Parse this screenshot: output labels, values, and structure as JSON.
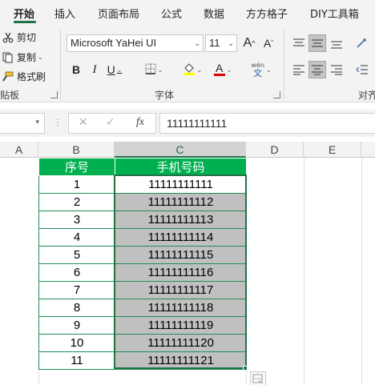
{
  "tabs": [
    "开始",
    "插入",
    "页面布局",
    "公式",
    "数据",
    "方方格子",
    "DIY工具箱"
  ],
  "clipboard": {
    "cut": "剪切",
    "copy": "复制",
    "format_painter": "格式刷",
    "group_label": "贴板"
  },
  "font": {
    "name": "Microsoft YaHei UI",
    "size": "11",
    "bold": "B",
    "italic": "I",
    "underline": "U",
    "group_label": "字体",
    "grow": "A",
    "shrink": "A",
    "phonetic_top": "wén",
    "phonetic_bottom": "文",
    "font_color": "A",
    "font_color_hex": "#e00000",
    "fill_color_hex": "#ffff00"
  },
  "alignment": {
    "group_label": "对齐"
  },
  "formula_bar": {
    "name_box": "",
    "cancel": "✕",
    "enter": "✓",
    "fx": "fx",
    "value": "11111111111"
  },
  "columns": [
    "A",
    "B",
    "C",
    "D",
    "E"
  ],
  "table": {
    "header": [
      "序号",
      "手机号码"
    ],
    "header_color": "#00b050",
    "rows": [
      [
        "1",
        "11111111111"
      ],
      [
        "2",
        "11111111112"
      ],
      [
        "3",
        "11111111113"
      ],
      [
        "4",
        "11111111114"
      ],
      [
        "5",
        "11111111115"
      ],
      [
        "6",
        "11111111116"
      ],
      [
        "7",
        "11111111117"
      ],
      [
        "8",
        "11111111118"
      ],
      [
        "9",
        "11111111119"
      ],
      [
        "10",
        "11111111120"
      ],
      [
        "11",
        "11111111121"
      ]
    ]
  },
  "accent_color": "#217346"
}
